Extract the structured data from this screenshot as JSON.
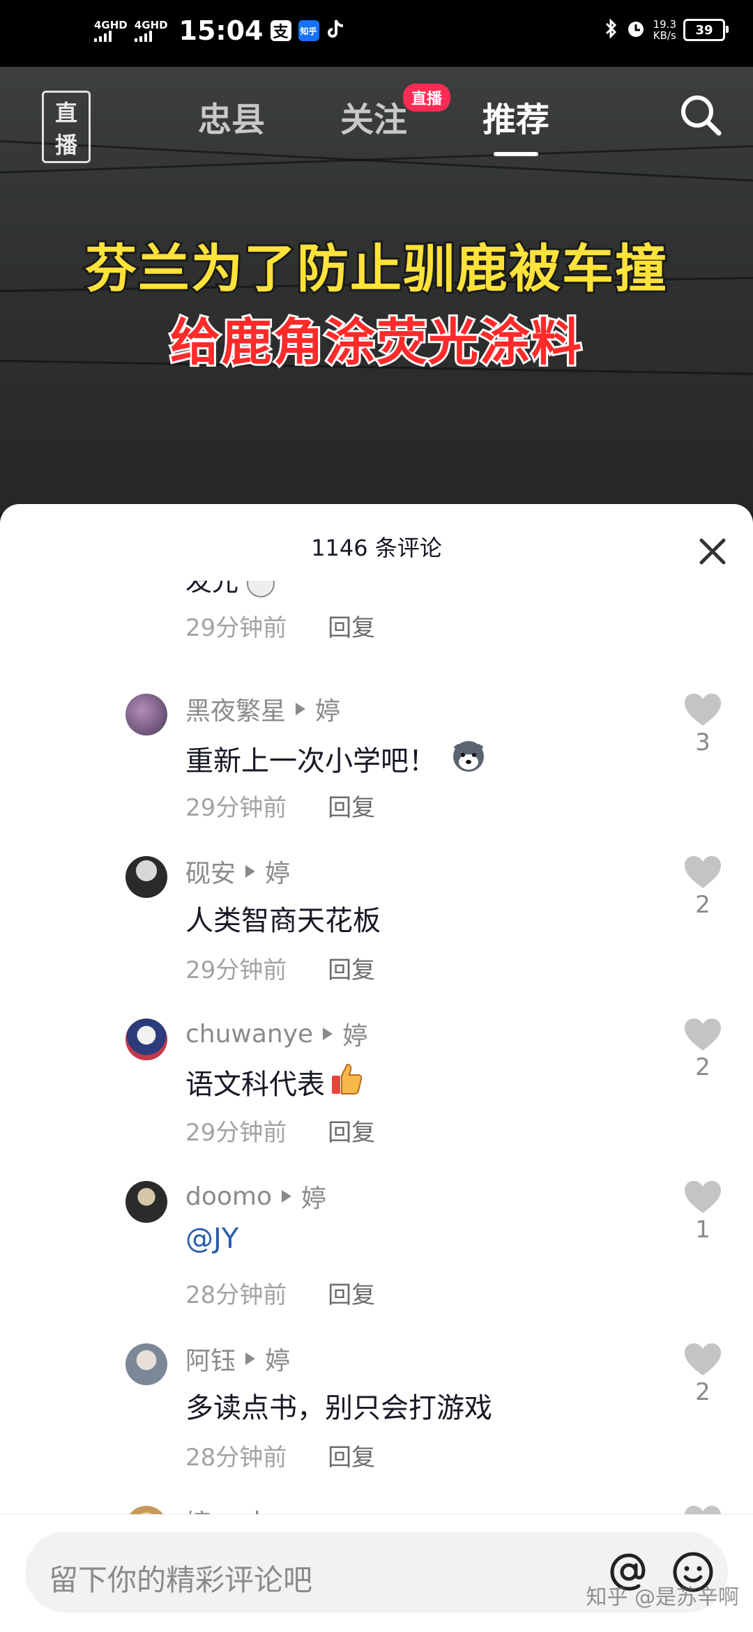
{
  "status_bar": {
    "network_1": "4GHD",
    "network_2": "4GHD",
    "time": "15:04",
    "zhihu_label": "知乎",
    "speed_value": "19.3",
    "speed_unit": "KB/s",
    "battery": "39"
  },
  "top_nav": {
    "live_icon_label": "直播",
    "tabs": [
      {
        "label": "忠县"
      },
      {
        "label": "关注"
      },
      {
        "label": "推荐"
      }
    ],
    "live_badge": "直播",
    "active_tab": "推荐"
  },
  "video": {
    "headline_1": "芬兰为了防止驯鹿被车撞",
    "headline_2": "给鹿角涂荧光涂料"
  },
  "comments_sheet": {
    "title": "1146 条评论",
    "cut_off_text": "发光",
    "first_meta_time": "29分钟前",
    "reply_label": "回复",
    "comments": [
      {
        "user": "黑夜繁星",
        "reply_to": "婷",
        "text": "重新上一次小学吧！",
        "time": "29分钟前",
        "likes": "3"
      },
      {
        "user": "砚安",
        "reply_to": "婷",
        "text": "人类智商天花板",
        "time": "29分钟前",
        "likes": "2"
      },
      {
        "user": "chuwanye",
        "reply_to": "婷",
        "text": "语文科代表",
        "time": "29分钟前",
        "likes": "2"
      },
      {
        "user": "doomo",
        "reply_to": "婷",
        "text": "@JY",
        "time": "28分钟前",
        "likes": "1"
      },
      {
        "user": "阿钰",
        "reply_to": "婷",
        "text": "多读点书，别只会打游戏",
        "time": "28分钟前",
        "likes": "2"
      }
    ],
    "partial_comment": {
      "user": "婷",
      "reply_to": "chuwanye"
    }
  },
  "input_bar": {
    "placeholder": "留下你的精彩评论吧"
  },
  "watermark": "知乎 @是苏辛啊"
}
